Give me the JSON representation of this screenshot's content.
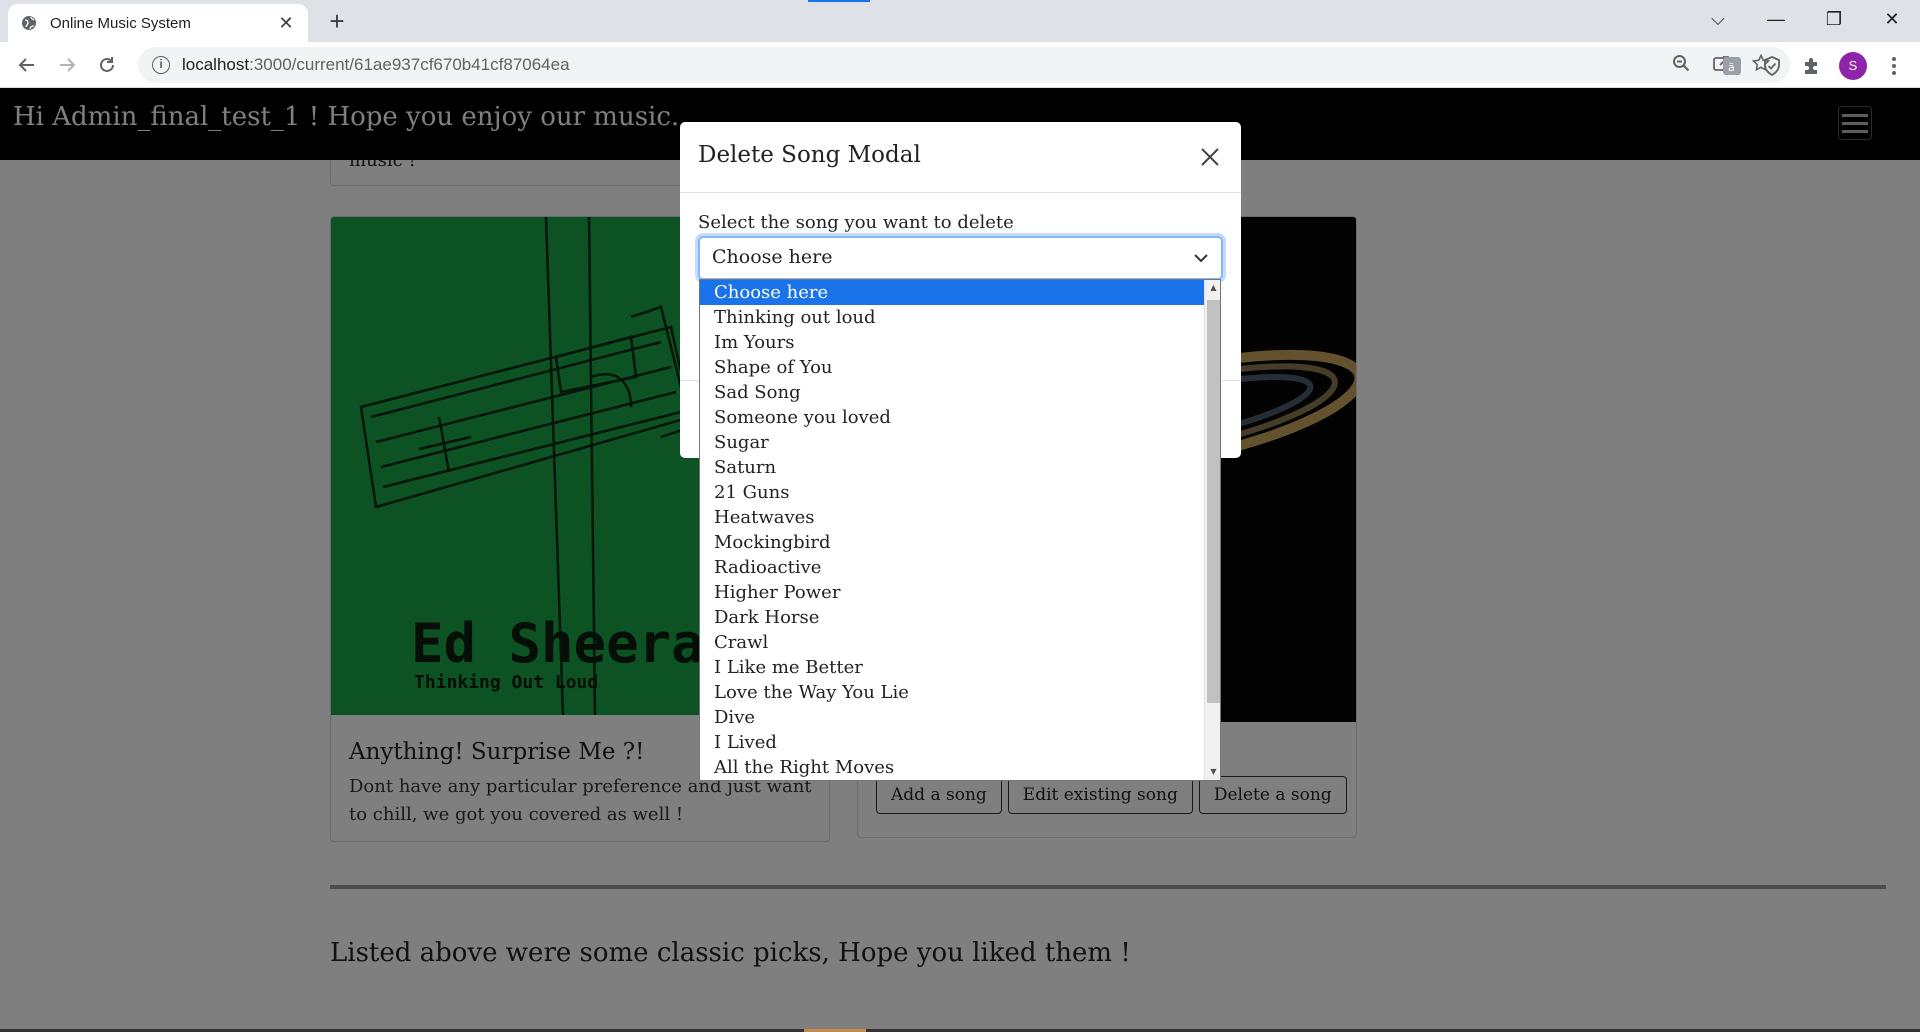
{
  "browser": {
    "tab_title": "Online Music System",
    "tab_close": "✕",
    "new_tab": "+",
    "url_host": "localhost",
    "url_rest": ":3000/current/61ae937cf670b41cf87064ea",
    "profile_initial": "S",
    "window_controls": {
      "chevron": "⌵",
      "minimize": "—",
      "restore": "❐",
      "close": "✕"
    }
  },
  "app": {
    "greeting": "Hi Admin_final_test_1 ! Hope you enjoy our music.",
    "top_card_cut_text": "music !",
    "cards": [
      {
        "title": "Anything! Surprise Me ?!",
        "text": "Dont have any particular preference and just want to chill, we got you covered as well !",
        "cover_artist": "Ed Sheeran",
        "cover_subtitle": "Thinking Out Loud"
      },
      {
        "title": "",
        "buttons": [
          "Add a song",
          "Edit existing song",
          "Delete a song"
        ]
      }
    ],
    "closing_text": "Listed above were some classic picks, Hope you liked them !"
  },
  "modal": {
    "title": "Delete Song Modal",
    "label": "Select the song you want to delete",
    "selected_value": "Choose here",
    "options": [
      "Choose here",
      "Thinking out loud",
      "Im Yours",
      "Shape of You",
      "Sad Song",
      "Someone you loved",
      "Sugar",
      "Saturn",
      "21 Guns",
      "Heatwaves",
      "Mockingbird",
      "Radioactive",
      "Higher Power",
      "Dark Horse",
      "Crawl",
      "I Like me Better",
      "Love the Way You Lie",
      "Dive",
      "I Lived",
      "All the Right Moves"
    ],
    "highlighted_option_index": 0
  },
  "colors": {
    "navbar": "#000000",
    "option_highlight": "#1a73e8",
    "green_cover": "#19a447",
    "focus_ring": "#86b7fe"
  }
}
